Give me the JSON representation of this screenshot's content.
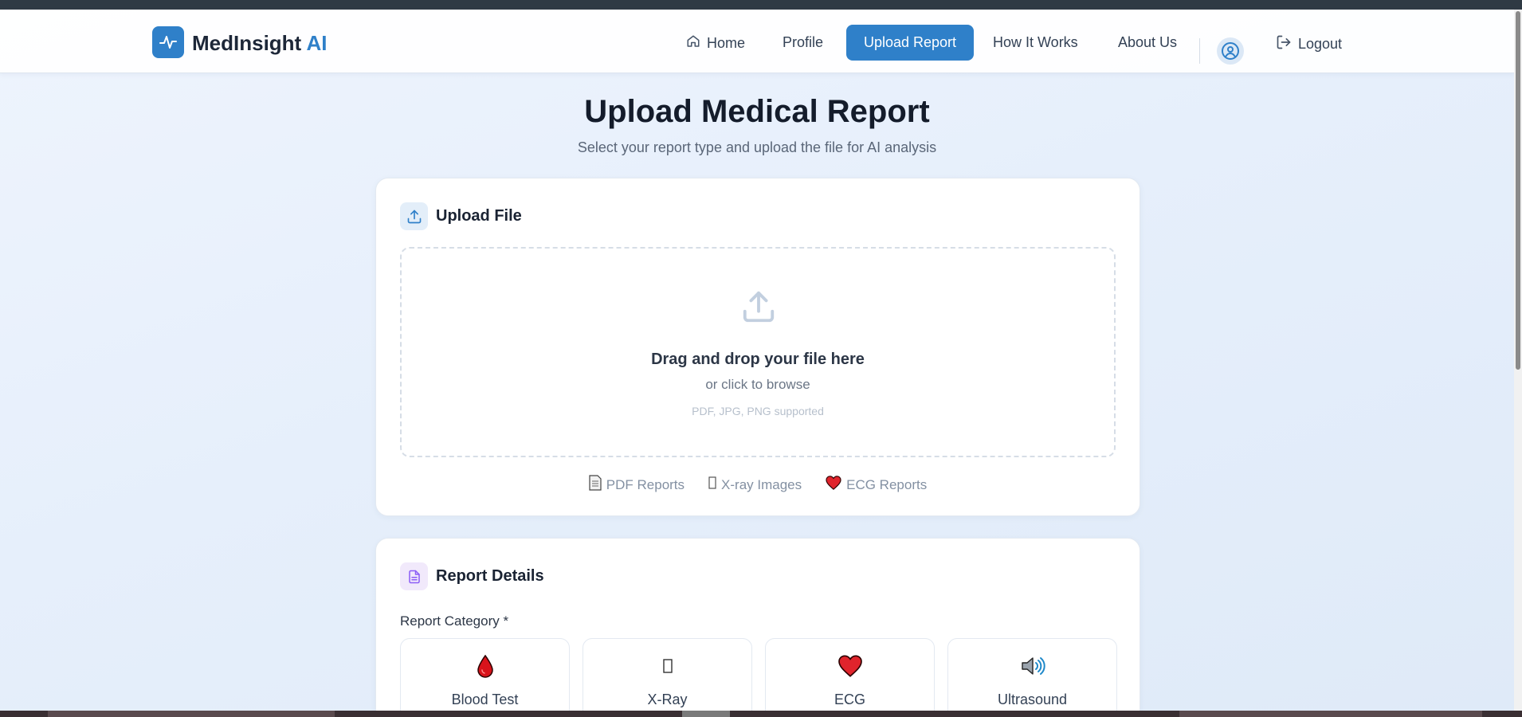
{
  "brand": {
    "name": "MedInsight",
    "accent": "AI",
    "brand_color": "#2f80c9",
    "logo_icon": "pulse-icon"
  },
  "nav": {
    "home": "Home",
    "profile": "Profile",
    "upload_report": "Upload Report",
    "how_it_works": "How It Works",
    "about_us": "About Us",
    "logout": "Logout"
  },
  "page": {
    "title": "Upload Medical Report",
    "subtitle": "Select your report type and upload the file for AI analysis"
  },
  "upload_card": {
    "title": "Upload File",
    "dropzone_title": "Drag and drop your file here",
    "dropzone_sub": "or click to browse",
    "dropzone_hint": "PDF, JPG, PNG supported",
    "types": [
      {
        "icon": "document-icon",
        "label": "PDF Reports"
      },
      {
        "icon": "missing-glyph-icon",
        "label": "X-ray Images"
      },
      {
        "icon": "heart-icon",
        "label": "ECG Reports"
      }
    ]
  },
  "details_card": {
    "title": "Report Details",
    "category_label": "Report Category *",
    "categories": [
      {
        "icon": "blood-drop-icon",
        "label": "Blood Test"
      },
      {
        "icon": "missing-glyph-icon",
        "label": "X-Ray"
      },
      {
        "icon": "heart-icon",
        "label": "ECG"
      },
      {
        "icon": "speaker-icon",
        "label": "Ultrasound"
      }
    ]
  }
}
